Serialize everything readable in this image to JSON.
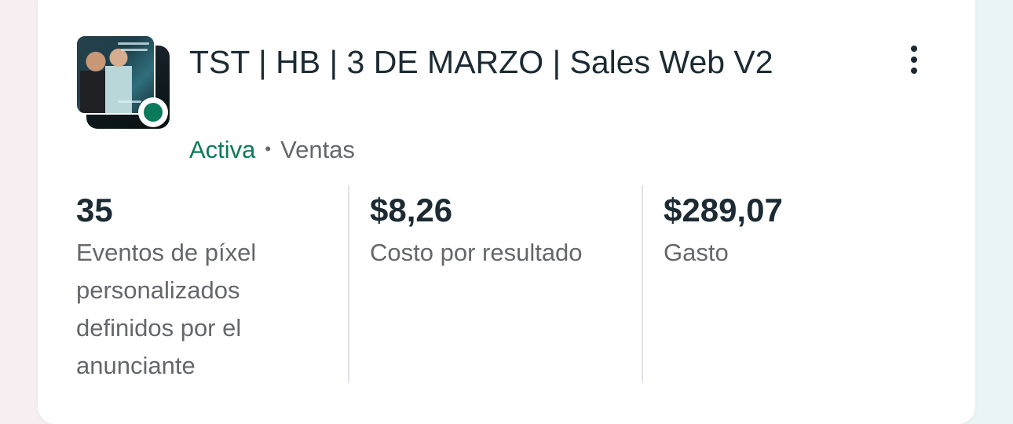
{
  "campaign": {
    "title": "TST | HB | 3 DE MARZO | Sales Web V2",
    "status": "Activa",
    "separator": "•",
    "objective": "Ventas",
    "status_color": "#0b7a5a",
    "thumbnail_icon": "campaign-creative-image"
  },
  "menu": {
    "icon": "more-vertical-icon"
  },
  "metrics": [
    {
      "value": "35",
      "label": "Eventos de píxel personalizados definidos por el anunciante"
    },
    {
      "value": "$8,26",
      "label": "Costo por resultado"
    },
    {
      "value": "$289,07",
      "label": "Gasto"
    }
  ]
}
